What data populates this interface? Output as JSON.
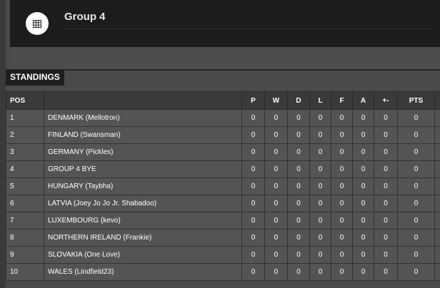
{
  "header": {
    "title": "Group 4",
    "icon": "table-grid-icon"
  },
  "standings": {
    "label": "STANDINGS",
    "columns": {
      "pos": "POS",
      "team": "",
      "p": "P",
      "w": "W",
      "d": "D",
      "l": "L",
      "f": "F",
      "a": "A",
      "gd": "+-",
      "pts": "PTS"
    },
    "rows": [
      {
        "pos": "1",
        "team": "DENMARK (Mellotron)",
        "p": "0",
        "w": "0",
        "d": "0",
        "l": "0",
        "f": "0",
        "a": "0",
        "gd": "0",
        "pts": "0"
      },
      {
        "pos": "2",
        "team": "FINLAND (Swansman)",
        "p": "0",
        "w": "0",
        "d": "0",
        "l": "0",
        "f": "0",
        "a": "0",
        "gd": "0",
        "pts": "0"
      },
      {
        "pos": "3",
        "team": "GERMANY (Pickles)",
        "p": "0",
        "w": "0",
        "d": "0",
        "l": "0",
        "f": "0",
        "a": "0",
        "gd": "0",
        "pts": "0"
      },
      {
        "pos": "4",
        "team": "GROUP 4 BYE",
        "p": "0",
        "w": "0",
        "d": "0",
        "l": "0",
        "f": "0",
        "a": "0",
        "gd": "0",
        "pts": "0"
      },
      {
        "pos": "5",
        "team": "HUNGARY (Taybha)",
        "p": "0",
        "w": "0",
        "d": "0",
        "l": "0",
        "f": "0",
        "a": "0",
        "gd": "0",
        "pts": "0"
      },
      {
        "pos": "6",
        "team": "LATVIA (Joey Jo Jo Jr. Shabadoo)",
        "p": "0",
        "w": "0",
        "d": "0",
        "l": "0",
        "f": "0",
        "a": "0",
        "gd": "0",
        "pts": "0"
      },
      {
        "pos": "7",
        "team": "LUXEMBOURG (kevo)",
        "p": "0",
        "w": "0",
        "d": "0",
        "l": "0",
        "f": "0",
        "a": "0",
        "gd": "0",
        "pts": "0"
      },
      {
        "pos": "8",
        "team": "NORTHERN IRELAND (Frankie)",
        "p": "0",
        "w": "0",
        "d": "0",
        "l": "0",
        "f": "0",
        "a": "0",
        "gd": "0",
        "pts": "0"
      },
      {
        "pos": "9",
        "team": "SLOVAKIA (One Love)",
        "p": "0",
        "w": "0",
        "d": "0",
        "l": "0",
        "f": "0",
        "a": "0",
        "gd": "0",
        "pts": "0"
      },
      {
        "pos": "10",
        "team": "WALES (Lindfield23)",
        "p": "0",
        "w": "0",
        "d": "0",
        "l": "0",
        "f": "0",
        "a": "0",
        "gd": "0",
        "pts": "0"
      }
    ]
  }
}
